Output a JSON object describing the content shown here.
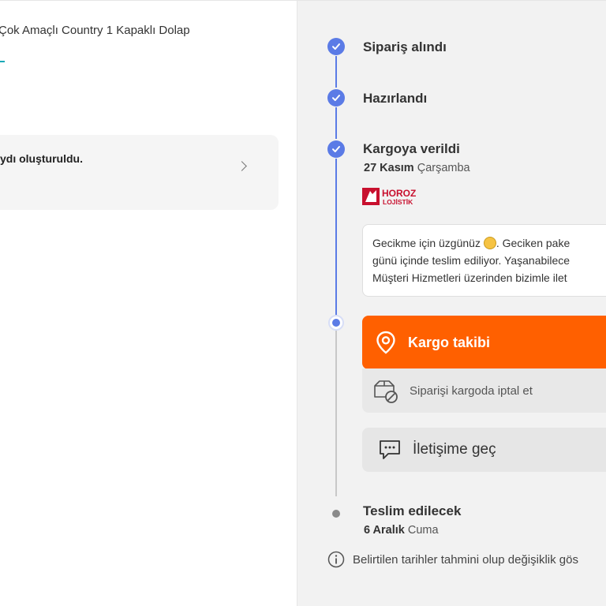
{
  "left": {
    "product_name": "Çok Amaçlı Country 1 Kapaklı Dolap",
    "card_text": "ydı oluşturuldu."
  },
  "timeline": {
    "steps": [
      {
        "title": "Sipariş alındı",
        "status": "done"
      },
      {
        "title": "Hazırlandı",
        "status": "done"
      },
      {
        "title": "Kargoya verildi",
        "status": "done",
        "date_bold": "27 Kasım",
        "date_rest": "Çarşamba"
      },
      {
        "title": "Teslim edilecek",
        "status": "upcoming",
        "date_bold": "6 Aralık",
        "date_rest": "Cuma"
      }
    ],
    "carrier": {
      "name": "HOROZ",
      "subname": "LOJİSTİK"
    }
  },
  "message": {
    "line1_a": "Gecikme için üzgünüz ",
    "line1_b": ". Geciken pake",
    "line2": "günü içinde teslim ediliyor. Yaşanabilece",
    "line3": "Müşteri Hizmetleri üzerinden bizimle ilet"
  },
  "actions": {
    "track_label": "Kargo takibi",
    "cancel_label": "Siparişi kargoda iptal et",
    "contact_label": "İletişime geç"
  },
  "note": "Belirtilen tarihler tahmini olup değişiklik gös",
  "colors": {
    "accent_blue": "#5b7be6",
    "primary_orange": "#ff6000",
    "carrier_red": "#c8102e"
  },
  "icons": [
    "check-icon",
    "location-pin-icon",
    "package-cancel-icon",
    "chat-bubble-icon",
    "info-icon",
    "chevron-right-icon"
  ]
}
